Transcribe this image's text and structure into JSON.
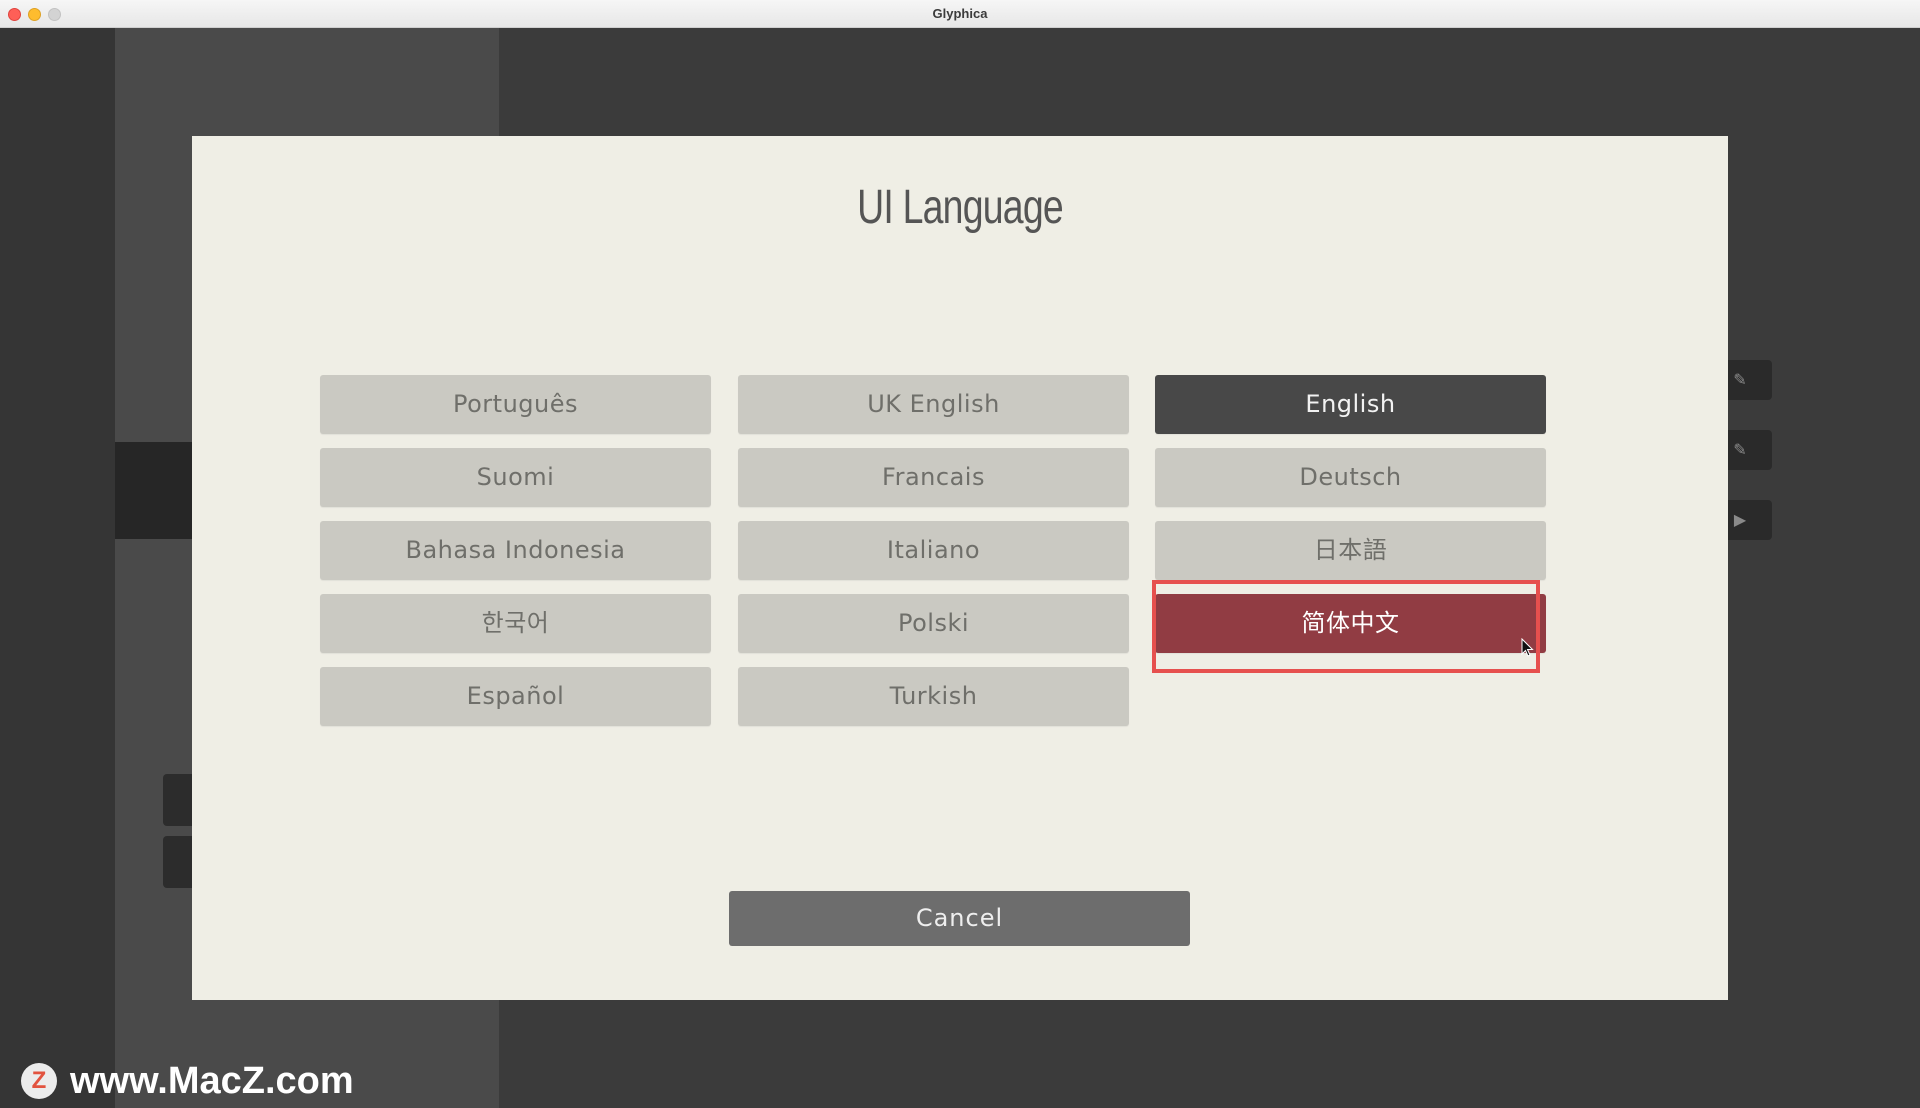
{
  "window": {
    "title": "Glyphica"
  },
  "dialog": {
    "title": "UI Language",
    "languages": [
      {
        "label": "Português",
        "state": "normal"
      },
      {
        "label": "UK English",
        "state": "normal"
      },
      {
        "label": "English",
        "state": "selected"
      },
      {
        "label": "Suomi",
        "state": "normal"
      },
      {
        "label": "Francais",
        "state": "normal"
      },
      {
        "label": "Deutsch",
        "state": "normal"
      },
      {
        "label": "Bahasa Indonesia",
        "state": "normal"
      },
      {
        "label": "Italiano",
        "state": "normal"
      },
      {
        "label": "日本語",
        "state": "normal"
      },
      {
        "label": "한국어",
        "state": "normal"
      },
      {
        "label": "Polski",
        "state": "normal"
      },
      {
        "label": "简体中文",
        "state": "hover"
      },
      {
        "label": "Español",
        "state": "normal"
      },
      {
        "label": "Turkish",
        "state": "normal"
      }
    ],
    "cancel_label": "Cancel"
  },
  "colors": {
    "dialog_bg": "#efeee5",
    "button_bg": "#cac9c2",
    "selected_bg": "#484848",
    "hover_bg": "#913c43",
    "highlight_border": "#e6504e",
    "cancel_bg": "#6d6d6d"
  },
  "background": {
    "icons": [
      "pencil-icon",
      "pencil-icon",
      "play-icon"
    ]
  },
  "watermark": {
    "logo_letter": "Z",
    "text": "www.MacZ.com"
  }
}
